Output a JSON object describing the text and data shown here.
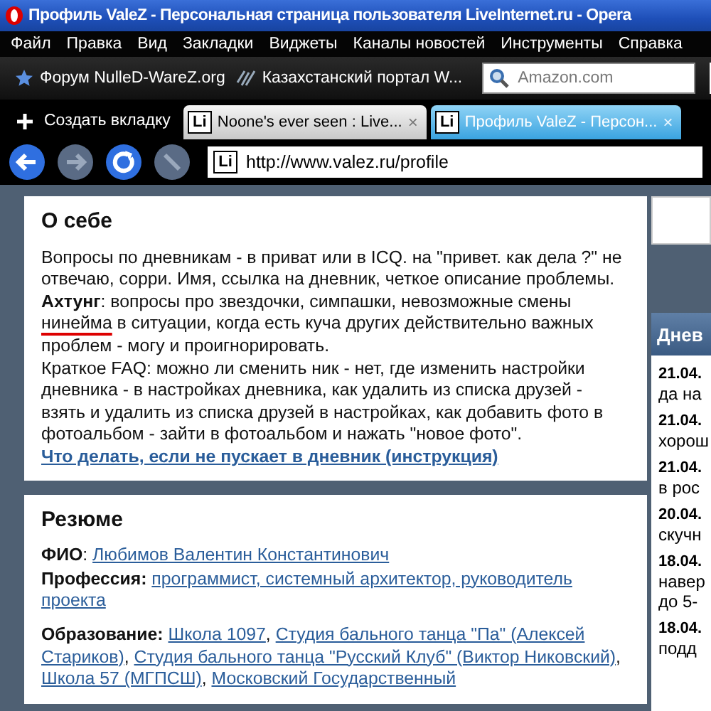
{
  "window": {
    "title": "Профиль ValeZ - Персональная страница пользователя LiveInternet.ru - Opera"
  },
  "menu": [
    "Файл",
    "Правка",
    "Вид",
    "Закладки",
    "Виджеты",
    "Каналы новостей",
    "Инструменты",
    "Справка"
  ],
  "bookmarks": [
    {
      "kind": "star",
      "label": "Форум NulleD-WareZ.org"
    },
    {
      "kind": "portal",
      "label": "Казахстанский портал W..."
    }
  ],
  "search": {
    "placeholder": "Amazon.com"
  },
  "new_tab": {
    "label": "Создать вкладку"
  },
  "tabs": [
    {
      "favicon": "Li",
      "label": "Noone's ever seen : Live...",
      "close": "×",
      "selected": false
    },
    {
      "favicon": "Li",
      "label": "Профиль ValeZ - Персон...",
      "close": "×",
      "selected": true
    }
  ],
  "nav_buttons": [
    {
      "kind": "back",
      "disabled": false
    },
    {
      "kind": "forward",
      "disabled": true
    },
    {
      "kind": "reload",
      "disabled": false
    },
    {
      "kind": "stop",
      "disabled": true
    }
  ],
  "address": {
    "favicon": "Li",
    "value": "http://www.valez.ru/profile"
  },
  "about": {
    "title": "О себе",
    "paragraphs": [
      [
        {
          "text": "Вопросы по дневникам - в приват или в ICQ. на \"привет. как дела ?\" не отвечаю, сорри. Имя, ссылка на дневник, четкое описание проблемы. **Ахтунг**: вопросы про звездочки, симпашки, невозможные смены ",
          "misspelled": false
        },
        {
          "text": "нинейма",
          "misspelled": true
        },
        {
          "text": " в ситуации, когда есть куча других действительно важных проблем - могу и проигнорировать.",
          "misspelled": false
        }
      ],
      [
        {
          "text": "Краткое FAQ: можно ли сменить ник - нет, где изменить настройки дневника - в настройках дневника, как удалить из списка друзей - взять и удалить из списка друзей в настройках, как добавить фото в фотоальбом - зайти в фотоальбом и нажать \"новое фото\".",
          "misspelled": false
        }
      ]
    ],
    "link": "Что делать, если не пускает в дневник (инструкция)"
  },
  "resume": {
    "title": "Резюме",
    "fields": [
      {
        "label": "**ФИО**:",
        "links": [
          {
            "text": "Любимов Валентин Константинович"
          }
        ]
      },
      {
        "label": "**Профессия:**",
        "links": [
          {
            "text": "программист, системный архитектор, руководитель проекта"
          }
        ]
      },
      {
        "label": "**Образование:**",
        "links": [
          {
            "text": "Школа 1097",
            "sep": ","
          },
          {
            "text": "Студия бального танца \"Па\" (Алексей Стариков)",
            "sep": ","
          },
          {
            "text": "Студия бального танца \"Русский Клуб\" (Виктор Никовский)",
            "sep": ","
          },
          {
            "text": "Школа 57 (МГПСШ)",
            "sep": ","
          },
          {
            "text": "Московский Государственный"
          }
        ]
      }
    ]
  },
  "side": {
    "title": "Днев",
    "entries": [
      {
        "date": "21.04.",
        "lines": [
          "да на"
        ]
      },
      {
        "date": "21.04.",
        "lines": [
          "хорош"
        ]
      },
      {
        "date": "21.04.",
        "lines": [
          "в рос"
        ]
      },
      {
        "date": "20.04.",
        "lines": [
          "скучн"
        ]
      },
      {
        "date": "18.04.",
        "lines": [
          "навер",
          "до 5-"
        ]
      },
      {
        "date": "18.04.",
        "lines": [
          "подд"
        ]
      }
    ]
  }
}
